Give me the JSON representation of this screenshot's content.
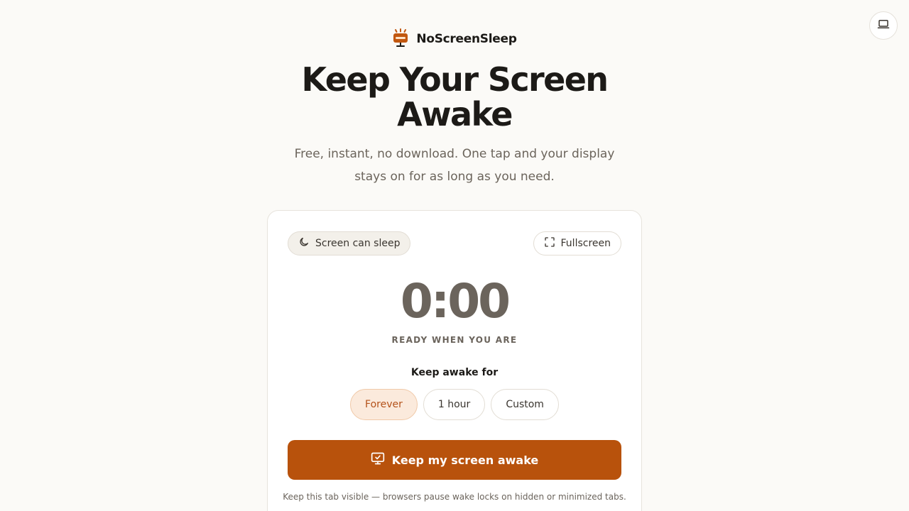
{
  "brand": {
    "name": "NoScreenSleep",
    "logo_icon": "lamp-icon",
    "accent_color": "#b8520c"
  },
  "theme_toggle": {
    "icon": "laptop-icon"
  },
  "hero": {
    "title": "Keep Your Screen Awake",
    "subtitle": "Free, instant, no download. One tap and your display stays on for as long as you need."
  },
  "card": {
    "status": {
      "label": "Screen can sleep",
      "icon": "moon-icon"
    },
    "fullscreen": {
      "label": "Fullscreen",
      "icon": "fullscreen-icon"
    },
    "timer": {
      "value": "0:00",
      "caption": "READY WHEN YOU ARE"
    },
    "duration": {
      "label": "Keep awake for",
      "options": [
        {
          "label": "Forever",
          "selected": true
        },
        {
          "label": "1 hour",
          "selected": false
        },
        {
          "label": "Custom",
          "selected": false
        }
      ]
    },
    "cta": {
      "label": "Keep my screen awake",
      "icon": "monitor-check-icon"
    },
    "hint": "Keep this tab visible — browsers pause wake locks on hidden or minimized tabs."
  }
}
